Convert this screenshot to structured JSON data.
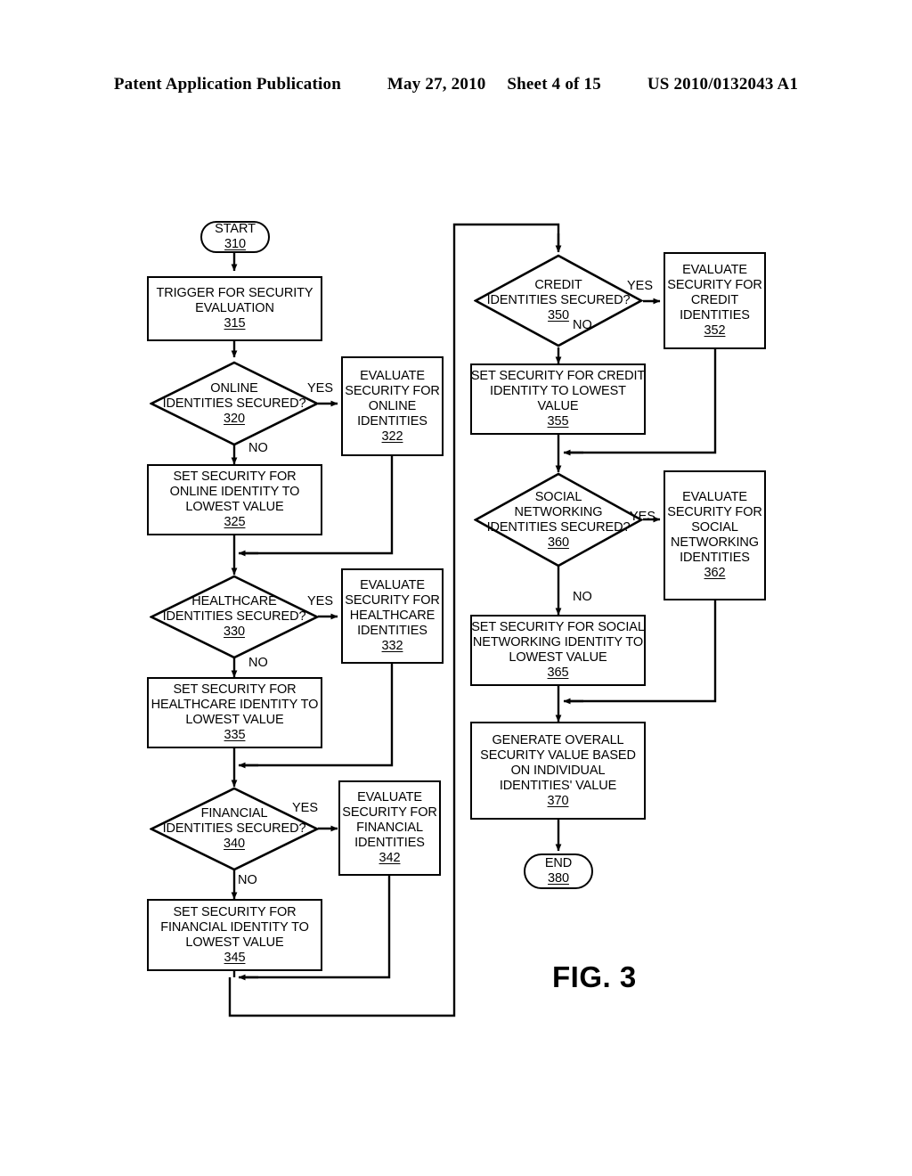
{
  "header": {
    "publication": "Patent Application Publication",
    "date": "May 27, 2010",
    "sheet": "Sheet 4 of 15",
    "patent_number": "US 2010/0132043 A1"
  },
  "figure": {
    "caption": "FIG. 3"
  },
  "nodes": {
    "start": {
      "line1": "START",
      "ref": "310"
    },
    "trigger": {
      "line1": "TRIGGER FOR SECURITY",
      "line2": "EVALUATION",
      "ref": "315"
    },
    "online_decision": {
      "line1": "ONLINE",
      "line2": "IDENTITIES SECURED?",
      "ref": "320"
    },
    "online_eval": {
      "line1": "EVALUATE",
      "line2": "SECURITY FOR",
      "line3": "ONLINE",
      "line4": "IDENTITIES",
      "ref": "322"
    },
    "online_set": {
      "line1": "SET SECURITY FOR",
      "line2": "ONLINE IDENTITY TO",
      "line3": "LOWEST VALUE",
      "ref": "325"
    },
    "healthcare_decision": {
      "line1": "HEALTHCARE",
      "line2": "IDENTITIES SECURED?",
      "ref": "330"
    },
    "healthcare_eval": {
      "line1": "EVALUATE",
      "line2": "SECURITY FOR",
      "line3": "HEALTHCARE",
      "line4": "IDENTITIES",
      "ref": "332"
    },
    "healthcare_set": {
      "line1": "SET SECURITY FOR",
      "line2": "HEALTHCARE IDENTITY TO",
      "line3": "LOWEST VALUE",
      "ref": "335"
    },
    "financial_decision": {
      "line1": "FINANCIAL",
      "line2": "IDENTITIES SECURED?",
      "ref": "340"
    },
    "financial_eval": {
      "line1": "EVALUATE",
      "line2": "SECURITY FOR",
      "line3": "FINANCIAL",
      "line4": "IDENTITIES",
      "ref": "342"
    },
    "financial_set": {
      "line1": "SET SECURITY FOR",
      "line2": "FINANCIAL IDENTITY TO",
      "line3": "LOWEST VALUE",
      "ref": "345"
    },
    "credit_decision": {
      "line1": "CREDIT",
      "line2": "IDENTITIES SECURED?",
      "ref": "350"
    },
    "credit_eval": {
      "line1": "EVALUATE",
      "line2": "SECURITY FOR",
      "line3": "CREDIT",
      "line4": "IDENTITIES",
      "ref": "352"
    },
    "credit_set": {
      "line1": "SET SECURITY FOR CREDIT",
      "line2": "IDENTITY TO LOWEST",
      "line3": "VALUE",
      "ref": "355"
    },
    "social_decision": {
      "line1": "SOCIAL",
      "line2": "NETWORKING",
      "line3": "IDENTITIES SECURED?",
      "ref": "360"
    },
    "social_eval": {
      "line1": "EVALUATE",
      "line2": "SECURITY FOR",
      "line3": "SOCIAL",
      "line4": "NETWORKING",
      "line5": "IDENTITIES",
      "ref": "362"
    },
    "social_set": {
      "line1": "SET SECURITY FOR SOCIAL",
      "line2": "NETWORKING IDENTITY TO",
      "line3": "LOWEST VALUE",
      "ref": "365"
    },
    "generate": {
      "line1": "GENERATE OVERALL",
      "line2": "SECURITY VALUE BASED",
      "line3": "ON INDIVIDUAL",
      "line4": "IDENTITIES' VALUE",
      "ref": "370"
    },
    "end": {
      "line1": "END",
      "ref": "380"
    }
  },
  "edge_labels": {
    "online_yes": "YES",
    "online_no": "NO",
    "healthcare_yes": "YES",
    "healthcare_no": "NO",
    "financial_yes": "YES",
    "financial_no": "NO",
    "credit_yes": "YES",
    "credit_no": "NO",
    "social_yes": "YES",
    "social_no": "NO"
  },
  "colors": {
    "ink": "#000000",
    "paper": "#ffffff"
  }
}
